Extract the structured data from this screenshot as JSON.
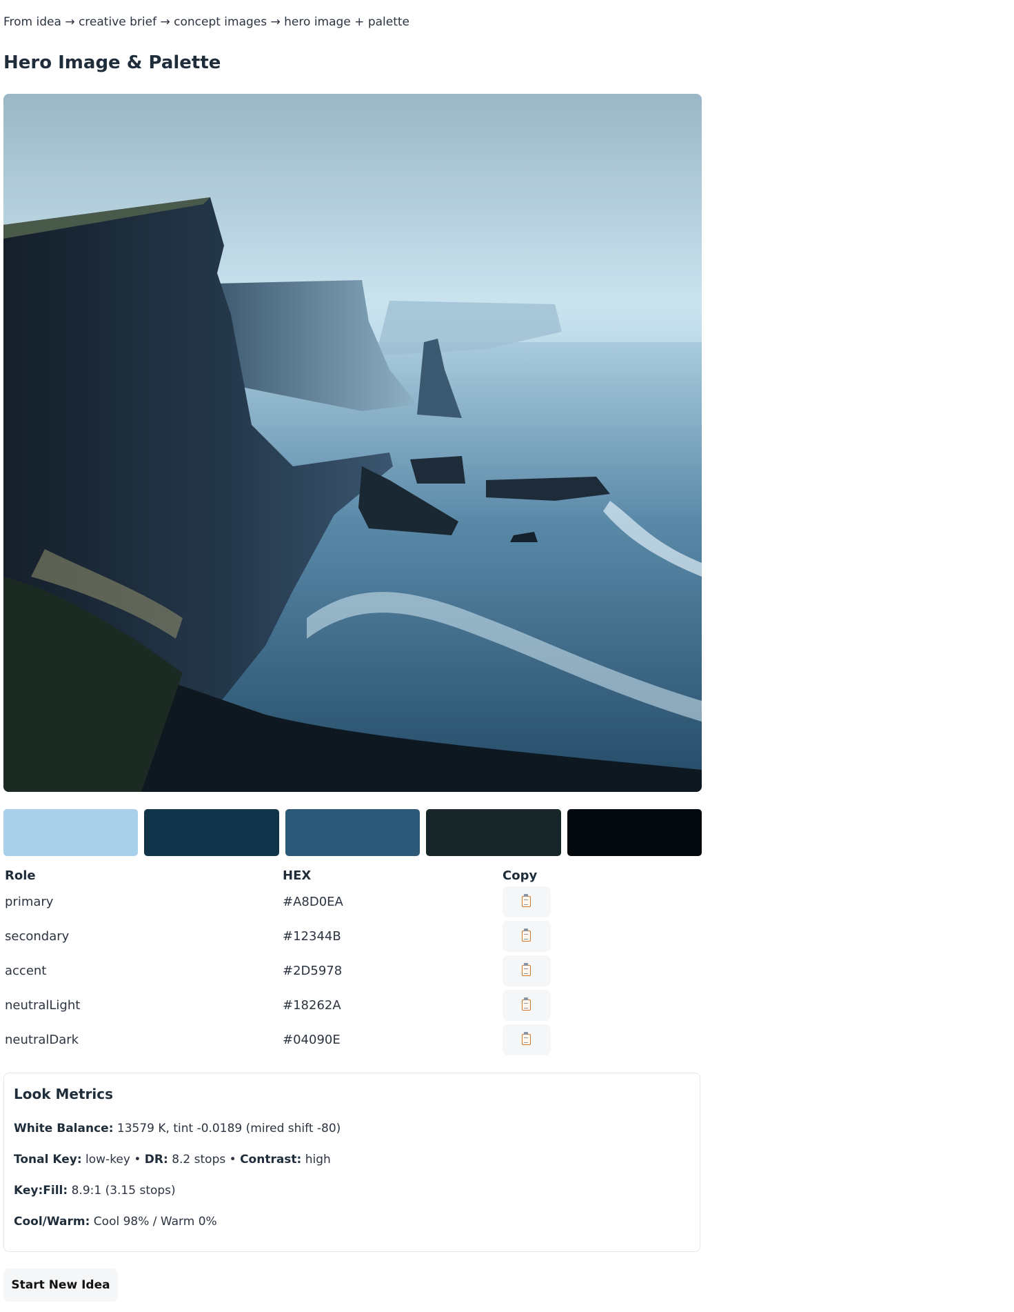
{
  "header": {
    "subtitle": "From idea → creative brief → concept images → hero image + palette",
    "title": "Hero Image & Palette"
  },
  "hero_image": {
    "subject": "misty sea cliffs with sea stacks and waves"
  },
  "palette": {
    "columns": {
      "role": "Role",
      "hex": "HEX",
      "copy": "Copy"
    },
    "rows": [
      {
        "role": "primary",
        "hex": "#A8D0EA"
      },
      {
        "role": "secondary",
        "hex": "#12344B"
      },
      {
        "role": "accent",
        "hex": "#2D5978"
      },
      {
        "role": "neutralLight",
        "hex": "#18262A"
      },
      {
        "role": "neutralDark",
        "hex": "#04090E"
      }
    ],
    "copy_icon": "clipboard-icon"
  },
  "metrics": {
    "title": "Look Metrics",
    "white_balance_label": "White Balance:",
    "white_balance_value": "13579 K,  tint -0.0189 (mired shift -80)",
    "tonal_key_label": "Tonal Key:",
    "tonal_key_value": "low-key",
    "separator": "•",
    "dr_label": "DR:",
    "dr_value": "8.2 stops",
    "contrast_label": "Contrast:",
    "contrast_value": "high",
    "key_fill_label": "Key:Fill:",
    "key_fill_value": "8.9:1 (3.15 stops)",
    "cool_warm_label": "Cool/Warm:",
    "cool_warm_value": "Cool 98% / Warm 0%"
  },
  "actions": {
    "start_new": "Start New Idea"
  }
}
